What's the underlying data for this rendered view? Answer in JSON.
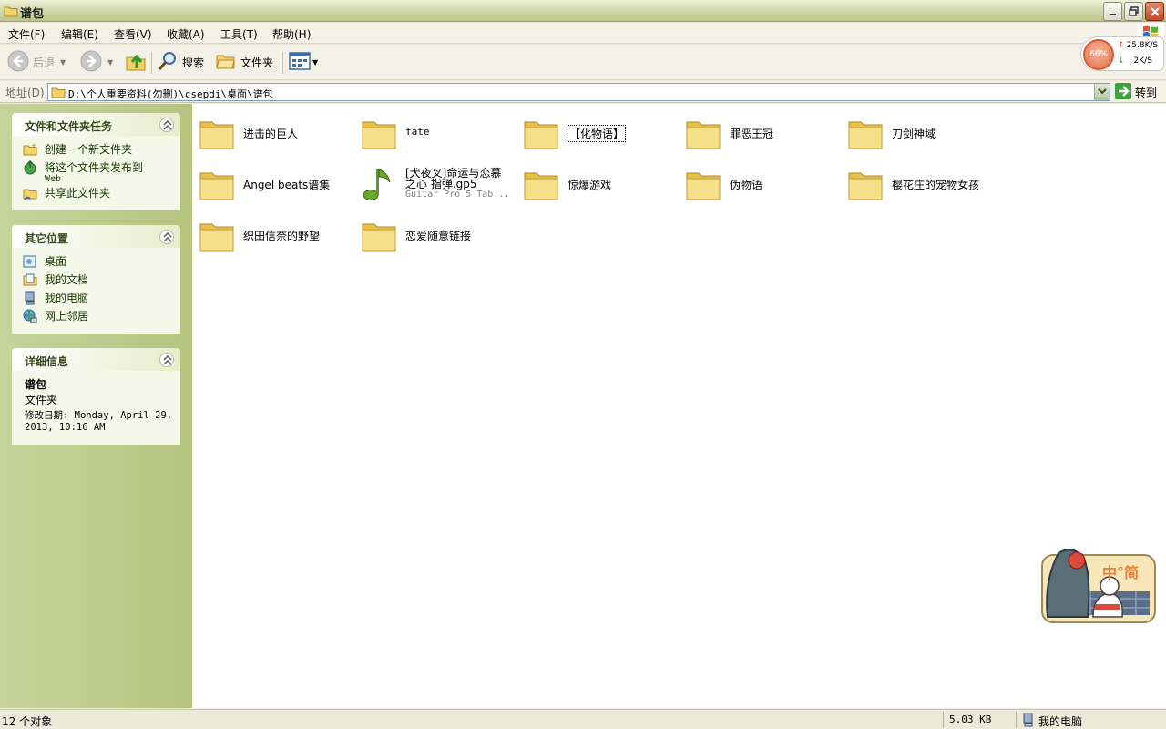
{
  "window": {
    "title": "谱包"
  },
  "menu": [
    "文件(F)",
    "编辑(E)",
    "查看(V)",
    "收藏(A)",
    "工具(T)",
    "帮助(H)"
  ],
  "toolbar": {
    "back_label": "后退",
    "search_label": "搜索",
    "folders_label": "文件夹"
  },
  "net_widget": {
    "percent": "66%",
    "up": "25.8K/S",
    "down": "2K/S"
  },
  "address": {
    "label": "地址(D)",
    "path": "D:\\个人重要资料(勿删)\\csepdi\\桌面\\谱包",
    "go_label": "转到"
  },
  "tasks_panel": {
    "title": "文件和文件夹任务",
    "items": [
      {
        "label": "创建一个新文件夹",
        "icon": "new-folder-icon"
      },
      {
        "label": "将这个文件夹发布到",
        "sub": "Web",
        "icon": "publish-web-icon"
      },
      {
        "label": "共享此文件夹",
        "icon": "share-folder-icon"
      }
    ]
  },
  "places_panel": {
    "title": "其它位置",
    "items": [
      {
        "label": "桌面",
        "icon": "desktop-icon"
      },
      {
        "label": "我的文档",
        "icon": "my-documents-icon"
      },
      {
        "label": "我的电脑",
        "icon": "my-computer-icon"
      },
      {
        "label": "网上邻居",
        "icon": "network-icon"
      }
    ]
  },
  "details_panel": {
    "title": "详细信息",
    "name": "谱包",
    "type": "文件夹",
    "modified": "修改日期: Monday, April 29, 2013, 10:16 AM"
  },
  "files": [
    {
      "name": "进击的巨人",
      "kind": "folder"
    },
    {
      "name": "fate",
      "kind": "folder"
    },
    {
      "name": "【化物语】",
      "kind": "folder",
      "selected": true
    },
    {
      "name": "罪恶王冠",
      "kind": "folder"
    },
    {
      "name": "刀剑神域",
      "kind": "folder"
    },
    {
      "name": "Angel beats谱集",
      "kind": "folder"
    },
    {
      "name": "[犬夜叉]命运与恋慕之心 指弹.gp5",
      "kind": "file",
      "type": "Guitar Pro 5 Tab..."
    },
    {
      "name": "惊爆游戏",
      "kind": "folder"
    },
    {
      "name": "伪物语",
      "kind": "folder"
    },
    {
      "name": "樱花庄的宠物女孩",
      "kind": "folder"
    },
    {
      "name": "织田信奈的野望",
      "kind": "folder"
    },
    {
      "name": "恋爱随意链接",
      "kind": "folder"
    }
  ],
  "mascot": {
    "text": "中°简"
  },
  "status": {
    "count": "12 个对象",
    "size": "5.03 KB",
    "location": "我的电脑"
  },
  "colors": {
    "titlebar": "#cfd6a8",
    "leftpane": "#c6d49c",
    "panel_body": "#f5f7e9",
    "folder_yellow": "#f7e08a",
    "close_red": "#c44a2c"
  }
}
